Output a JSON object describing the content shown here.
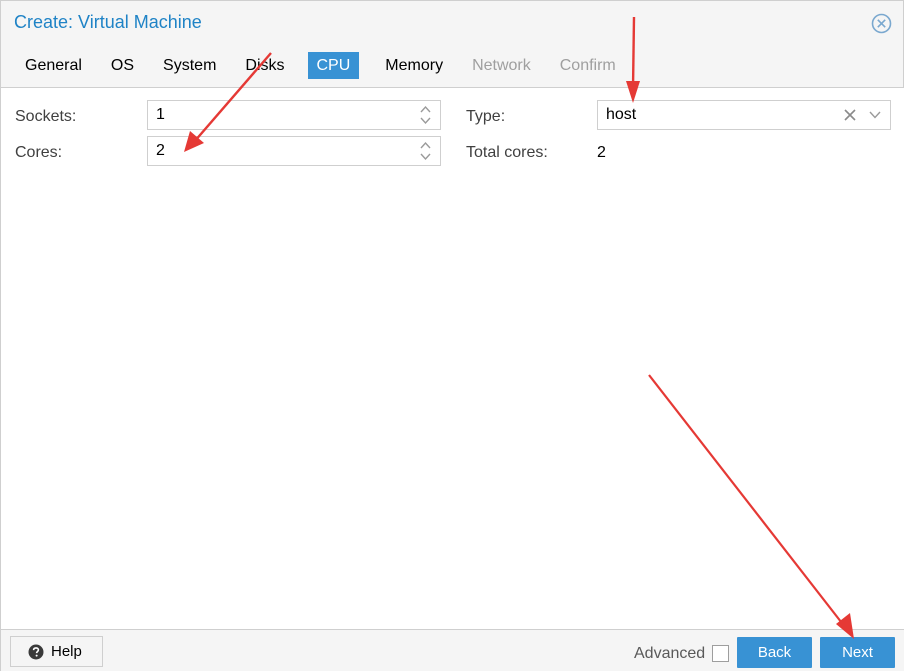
{
  "window": {
    "title": "Create: Virtual Machine"
  },
  "tabs": [
    {
      "label": "General",
      "state": "normal"
    },
    {
      "label": "OS",
      "state": "normal"
    },
    {
      "label": "System",
      "state": "normal"
    },
    {
      "label": "Disks",
      "state": "normal"
    },
    {
      "label": "CPU",
      "state": "active"
    },
    {
      "label": "Memory",
      "state": "normal"
    },
    {
      "label": "Network",
      "state": "disabled"
    },
    {
      "label": "Confirm",
      "state": "disabled"
    }
  ],
  "form": {
    "sockets": {
      "label": "Sockets:",
      "value": "1"
    },
    "cores": {
      "label": "Cores:",
      "value": "2"
    },
    "type": {
      "label": "Type:",
      "value": "host"
    },
    "total_cores": {
      "label": "Total cores:",
      "value": "2"
    }
  },
  "footer": {
    "help_label": "Help",
    "advanced_label": "Advanced",
    "advanced_checked": false,
    "back_label": "Back",
    "next_label": "Next"
  },
  "colors": {
    "accent": "#3892d4",
    "title": "#1f83c6",
    "annotation_arrow": "#e53935"
  },
  "icons": {
    "close": "close-circle-icon",
    "help": "question-circle-icon",
    "spinner": "up-down-chevron-icon",
    "clear": "x-icon",
    "dropdown": "chevron-down-icon"
  }
}
